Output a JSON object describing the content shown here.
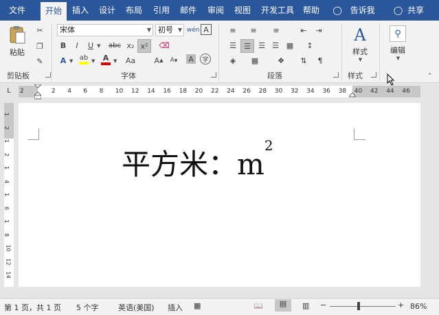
{
  "tabs": {
    "file": "文件",
    "home": "开始",
    "insert": "插入",
    "design": "设计",
    "layout": "布局",
    "references": "引用",
    "mailings": "邮件",
    "review": "审阅",
    "view": "视图",
    "developer": "开发工具",
    "help": "帮助",
    "tell_me": "告诉我",
    "share": "共享"
  },
  "clipboard": {
    "paste": "粘贴",
    "label": "剪贴板"
  },
  "font": {
    "family": "宋体",
    "size": "初号",
    "label": "字体",
    "bold": "B",
    "italic": "I",
    "underline": "U",
    "strike": "abc",
    "subscript": "x₂",
    "superscript": "x²",
    "font_a": "A",
    "char_border": "A"
  },
  "paragraph": {
    "label": "段落"
  },
  "styles": {
    "button": "样式",
    "label": "样式"
  },
  "editing": {
    "button": "编辑"
  },
  "ruler": {
    "ticks": [
      "2",
      "2",
      "4",
      "6",
      "8",
      "10",
      "12",
      "14",
      "16",
      "18",
      "20",
      "22",
      "24",
      "26",
      "28",
      "30",
      "32",
      "34",
      "36",
      "38",
      "40",
      "42",
      "44",
      "46"
    ],
    "vticks": [
      "1",
      "2",
      "1",
      "2",
      "1",
      "4",
      "1",
      "6",
      "1",
      "8",
      "10",
      "12",
      "14"
    ]
  },
  "document": {
    "text": "平方米：m",
    "sup": "2"
  },
  "status": {
    "page": "第 1 页，共 1 页",
    "words": "5 个字",
    "language": "英语(美国)",
    "mode": "插入",
    "zoom": "86%"
  },
  "colors": {
    "accent": "#2b579a",
    "highlight": "#ffff00",
    "font_color": "#e00000"
  }
}
